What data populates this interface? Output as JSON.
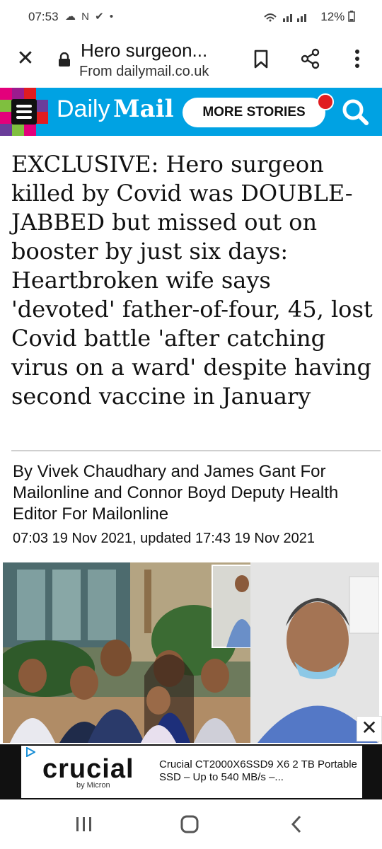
{
  "status": {
    "time": "07:53",
    "left_icons": "☁ N ✔ •",
    "battery": "12%"
  },
  "toolbar": {
    "title": "Hero surgeon...",
    "subtitle": "From dailymail.co.uk",
    "icons": [
      "close-icon",
      "lock-icon",
      "bookmark-icon",
      "share-icon",
      "more-icon"
    ]
  },
  "header": {
    "logo_daily": "Daily",
    "logo_mail": "Mail",
    "more_stories": "MORE STORIES",
    "accent": "#00a2e3",
    "notification_color": "#e01c20"
  },
  "article": {
    "headline": "EXCLUSIVE: Hero surgeon killed by Covid was DOUBLE-JABBED but missed out on booster by just six days: Heartbroken wife says 'devoted' father-of-four, 45, lost Covid battle 'after catching virus on a ward' despite having second vaccine in January",
    "byline": "By Vivek Chaudhary and James Gant For Mailonline and Connor Boyd Deputy Health Editor For Mailonline",
    "dateline": "07:03 19 Nov 2021, updated 17:43 19 Nov 2021"
  },
  "ad": {
    "brand": "crucial",
    "sub_brand": "by Micron",
    "text": "Crucial CT2000X6SSD9 X6 2 TB Portable SSD – Up to 540 MB/s –..."
  },
  "nav": {
    "icons": [
      "recents-icon",
      "home-icon",
      "back-icon"
    ]
  }
}
